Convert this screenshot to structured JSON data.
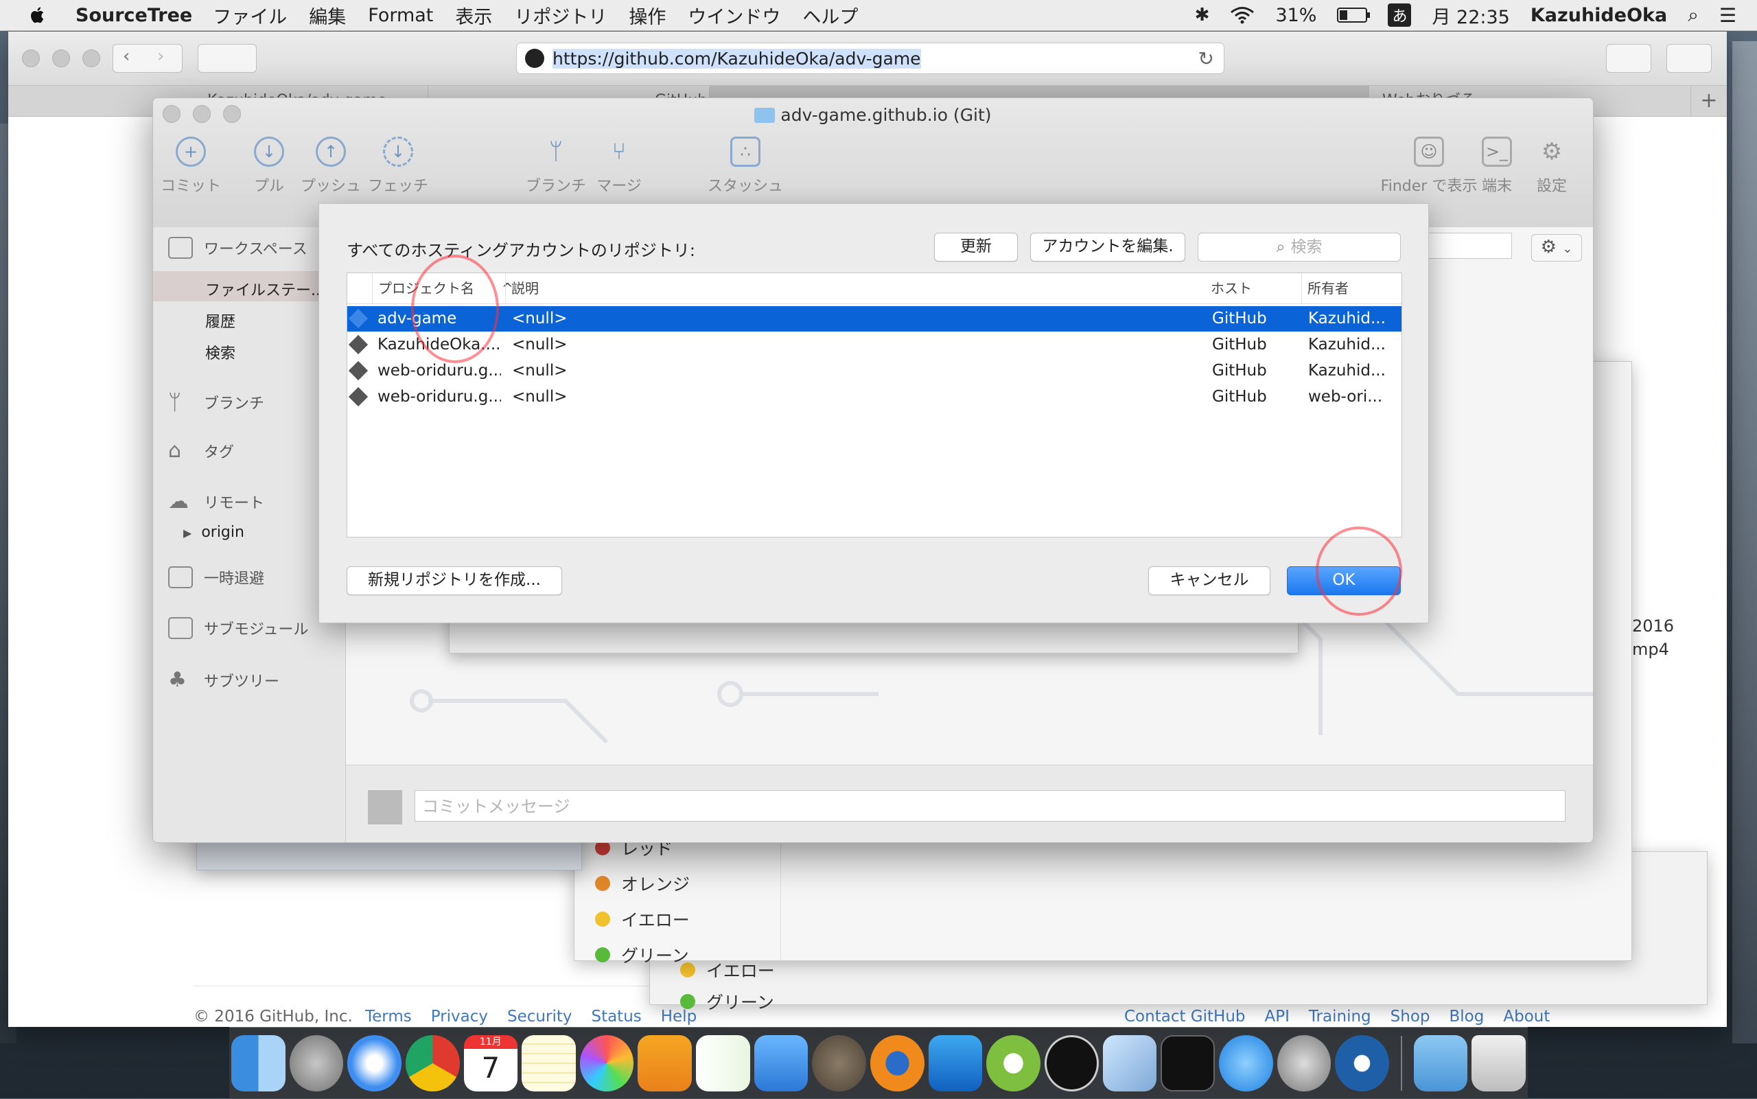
{
  "menubar": {
    "app_name": "SourceTree",
    "items": [
      "ファイル",
      "編集",
      "Format",
      "表示",
      "リポジトリ",
      "操作",
      "ウインドウ",
      "ヘルプ"
    ],
    "battery": "31%",
    "ime": "あ",
    "clock": "月 22:35",
    "user": "KazuhideOka"
  },
  "safari": {
    "url": "https://github.com/KazuhideOka/adv-game",
    "tabs": [
      "KazuhideOka/adv-game",
      "GitHub D...",
      "",
      "Webおりづる"
    ],
    "footer_copyright": "© 2016 GitHub, Inc.",
    "footer_links_left": [
      "Terms",
      "Privacy",
      "Security",
      "Status",
      "Help"
    ],
    "footer_links_right": [
      "Contact GitHub",
      "API",
      "Training",
      "Shop",
      "Blog",
      "About"
    ],
    "right_text_1": "2016",
    "right_text_2": "mp4"
  },
  "bg_colors": {
    "items": [
      {
        "label": "レッド",
        "color": "#d8403a"
      },
      {
        "label": "オレンジ",
        "color": "#e58b2a"
      },
      {
        "label": "イエロー",
        "color": "#f2c12e"
      },
      {
        "label": "グリーン",
        "color": "#58b93a"
      }
    ],
    "lower_items": [
      {
        "label": "イエロー",
        "color": "#f2c12e"
      },
      {
        "label": "グリーン",
        "color": "#58b93a"
      }
    ]
  },
  "sourcetree": {
    "title": "adv-game.github.io (Git)",
    "toolbar": {
      "commit": "コミット",
      "pull": "プル",
      "push": "プッシュ",
      "fetch": "フェッチ",
      "branch": "ブランチ",
      "merge": "マージ",
      "stash": "スタッシュ",
      "finder": "Finder で表示",
      "terminal": "端末",
      "settings": "設定"
    },
    "sidebar": {
      "workspace": "ワークスペース",
      "file_status": "ファイルステー...",
      "history": "履歴",
      "search": "検索",
      "branches": "ブランチ",
      "tags": "タグ",
      "remotes": "リモート",
      "origin": "origin",
      "stashes": "一時退避",
      "submodules": "サブモジュール",
      "subtrees": "サブツリー"
    },
    "commit_placeholder": "コミットメッセージ"
  },
  "dialog": {
    "label": "すべてのホスティングアカウントのリポジトリ:",
    "refresh": "更新",
    "edit_accounts": "アカウントを編集.",
    "search_placeholder": "検索",
    "columns": {
      "project": "プロジェクト名",
      "sort": "^",
      "description": "説明",
      "host": "ホスト",
      "owner": "所有者"
    },
    "rows": [
      {
        "project": "adv-game",
        "description": "<null>",
        "host": "GitHub",
        "owner": "Kazuhid...",
        "selected": true
      },
      {
        "project": "KazuhideOka....",
        "description": "<null>",
        "host": "GitHub",
        "owner": "Kazuhid...",
        "selected": false
      },
      {
        "project": "web-oriduru.g...",
        "description": "<null>",
        "host": "GitHub",
        "owner": "Kazuhid...",
        "selected": false
      },
      {
        "project": "web-oriduru.g...",
        "description": "<null>",
        "host": "GitHub",
        "owner": "web-ori...",
        "selected": false
      }
    ],
    "create_new": "新規リポジトリを作成...",
    "cancel": "キャンセル",
    "ok": "OK"
  },
  "dock": {
    "apps": [
      "finder",
      "launchpad",
      "safari",
      "chrome",
      "calendar",
      "notes",
      "photos",
      "pages",
      "numbers",
      "keynote",
      "gimp",
      "blender",
      "xcode",
      "android-studio",
      "brackets",
      "virtualbox",
      "terminal",
      "app-store",
      "system-preferences",
      "sourcetree",
      "downloads",
      "trash"
    ],
    "calendar_day": "7",
    "calendar_month": "11月"
  }
}
